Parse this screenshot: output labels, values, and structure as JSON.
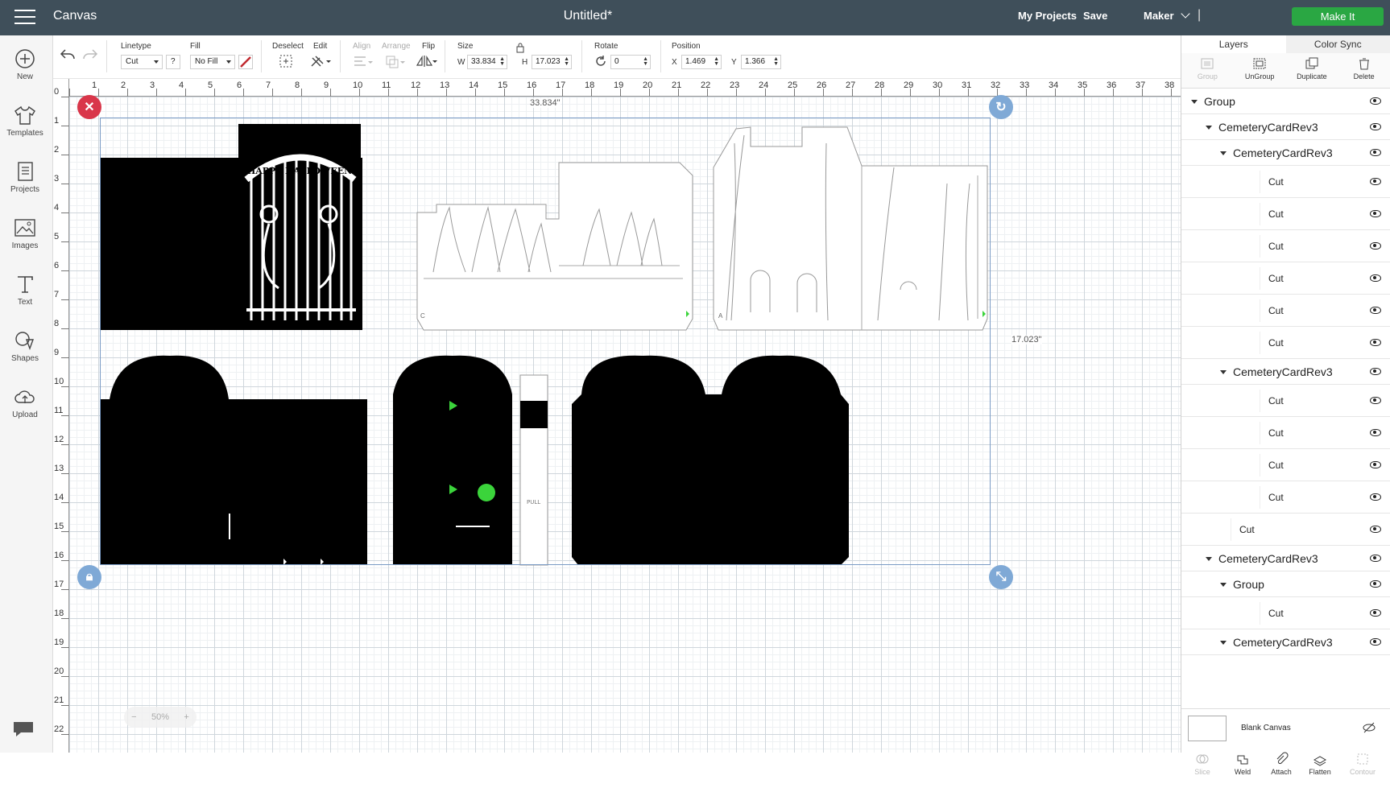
{
  "topbar": {
    "app_title": "Canvas",
    "doc_title": "Untitled*",
    "my_projects": "My Projects",
    "save": "Save",
    "separator": "|",
    "machine": "Maker",
    "make_it": "Make It"
  },
  "leftbar": {
    "items": [
      {
        "label": "New",
        "icon": "plus-circle-icon"
      },
      {
        "label": "Templates",
        "icon": "tshirt-icon"
      },
      {
        "label": "Projects",
        "icon": "book-icon"
      },
      {
        "label": "Images",
        "icon": "image-icon"
      },
      {
        "label": "Text",
        "icon": "text-icon"
      },
      {
        "label": "Shapes",
        "icon": "shapes-icon"
      },
      {
        "label": "Upload",
        "icon": "cloud-upload-icon"
      }
    ]
  },
  "toolbar": {
    "linetype_label": "Linetype",
    "linetype_value": "Cut",
    "linetype_help": "?",
    "fill_label": "Fill",
    "fill_value": "No Fill",
    "deselect_label": "Deselect",
    "edit_label": "Edit",
    "align_label": "Align",
    "arrange_label": "Arrange",
    "flip_label": "Flip",
    "size_label": "Size",
    "w_label": "W",
    "w_value": "33.834",
    "h_label": "H",
    "h_value": "17.023",
    "rotate_label": "Rotate",
    "rotate_value": "0",
    "position_label": "Position",
    "x_label": "X",
    "x_value": "1.469",
    "y_label": "Y",
    "y_value": "1.366"
  },
  "ruler": {
    "h_ticks": [
      "0",
      "1",
      "2",
      "3",
      "4",
      "5",
      "6",
      "7",
      "8",
      "9",
      "10",
      "11",
      "12",
      "13",
      "14",
      "15",
      "16",
      "17",
      "18",
      "19",
      "20",
      "21",
      "22",
      "23",
      "24",
      "25",
      "26",
      "27",
      "28",
      "29",
      "30",
      "31",
      "32",
      "33",
      "34",
      "35",
      "36",
      "37",
      "38"
    ],
    "v_ticks": [
      "0",
      "1",
      "2",
      "3",
      "4",
      "5",
      "6",
      "7",
      "8",
      "9",
      "10",
      "11",
      "12",
      "13",
      "14",
      "15",
      "16",
      "17",
      "18",
      "19",
      "20",
      "21",
      "22"
    ]
  },
  "canvas": {
    "width_dim": "33.834\"",
    "height_dim": "17.023\"",
    "zoom": "50%",
    "zoom_minus": "−",
    "zoom_plus": "+",
    "gate_text": "HAPPY HALLOWEEN",
    "pull_text": "PULL",
    "card_c": "C",
    "card_a": "A"
  },
  "panel": {
    "tabs": [
      "Layers",
      "Color Sync"
    ],
    "buttons": [
      {
        "label": "Group",
        "enabled": false
      },
      {
        "label": "UnGroup",
        "enabled": true
      },
      {
        "label": "Duplicate",
        "enabled": true
      },
      {
        "label": "Delete",
        "enabled": true
      }
    ],
    "layers": [
      {
        "label": "Group",
        "depth": 0,
        "expand": true
      },
      {
        "label": "CemeteryCardRev3",
        "depth": 1,
        "expand": true
      },
      {
        "label": "CemeteryCardRev3",
        "depth": 2,
        "expand": true
      },
      {
        "label": "Cut",
        "depth": 3,
        "expand": false
      },
      {
        "label": "Cut",
        "depth": 3,
        "expand": false
      },
      {
        "label": "Cut",
        "depth": 3,
        "expand": false
      },
      {
        "label": "Cut",
        "depth": 3,
        "expand": false
      },
      {
        "label": "Cut",
        "depth": 3,
        "expand": false
      },
      {
        "label": "Cut",
        "depth": 3,
        "expand": false
      },
      {
        "label": "CemeteryCardRev3",
        "depth": 2,
        "expand": true
      },
      {
        "label": "Cut",
        "depth": 3,
        "expand": false
      },
      {
        "label": "Cut",
        "depth": 3,
        "expand": false
      },
      {
        "label": "Cut",
        "depth": 3,
        "expand": false
      },
      {
        "label": "Cut",
        "depth": 3,
        "expand": false
      },
      {
        "label": "Cut",
        "depth": 1,
        "expand": false
      },
      {
        "label": "CemeteryCardRev3",
        "depth": 1,
        "expand": true
      },
      {
        "label": "Group",
        "depth": 2,
        "expand": true
      },
      {
        "label": "Cut",
        "depth": 3,
        "expand": false
      },
      {
        "label": "CemeteryCardRev3",
        "depth": 2,
        "expand": true
      }
    ],
    "blank_canvas": "Blank Canvas",
    "bottom_buttons": [
      {
        "label": "Slice",
        "enabled": false
      },
      {
        "label": "Weld",
        "enabled": true
      },
      {
        "label": "Attach",
        "enabled": true
      },
      {
        "label": "Flatten",
        "enabled": true
      },
      {
        "label": "Contour",
        "enabled": false
      }
    ]
  },
  "colors": {
    "topbar_bg": "#3f4f5a",
    "make_it_bg": "#2aa743",
    "handle_blue": "#7fa9d6",
    "delete_red": "#d9364a",
    "accent_green": "#3bd43b"
  }
}
